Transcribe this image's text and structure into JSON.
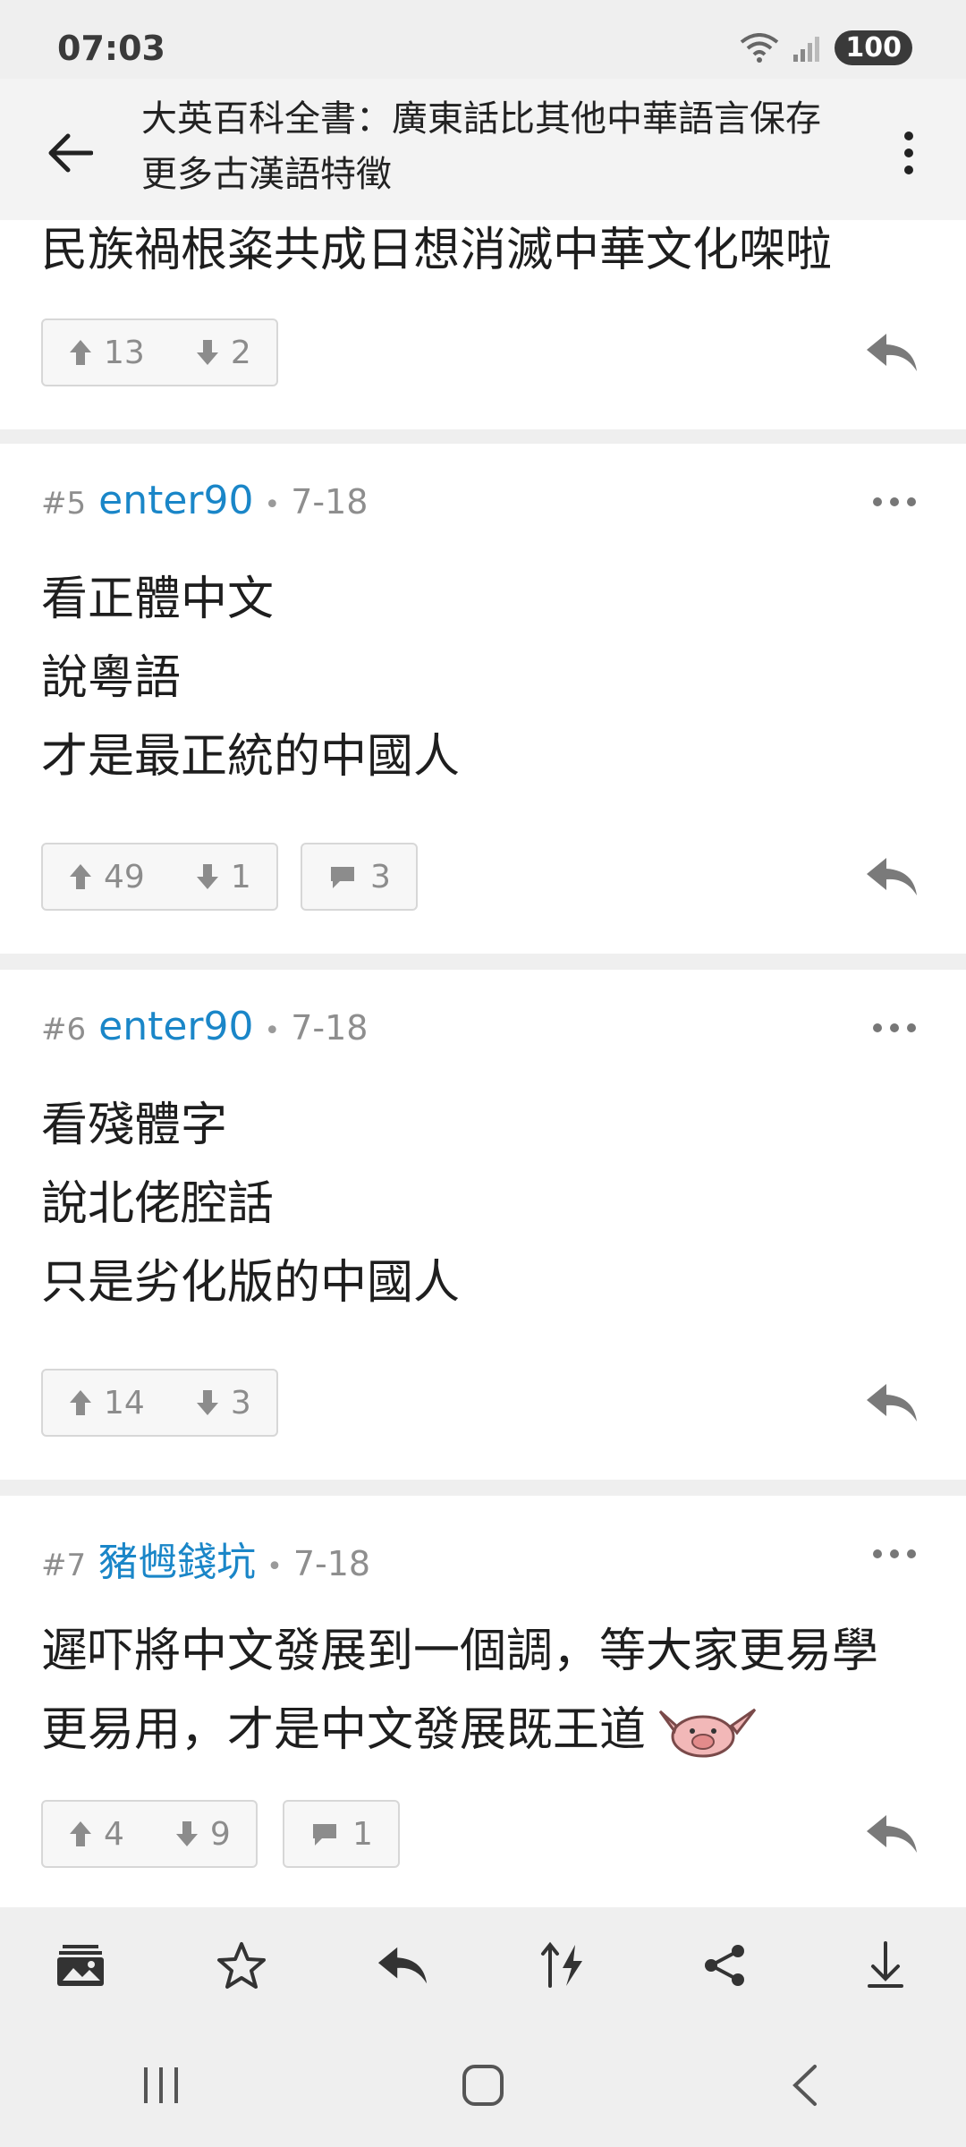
{
  "status": {
    "time": "07:03",
    "battery": "100"
  },
  "header": {
    "title": "大英百科全書：廣東話比其他中華語言保存更多古漢語特徵"
  },
  "posts": [
    {
      "body_lines": [
        "民族禍根粢共成日想消滅中華文化㗎啦"
      ],
      "up": "13",
      "down": "2"
    },
    {
      "number": "#5",
      "user": "enter90",
      "date": "7-18",
      "body_lines": [
        "看正體中文",
        "說粵語",
        "才是最正統的中國人"
      ],
      "up": "49",
      "down": "1",
      "comments": "3"
    },
    {
      "number": "#6",
      "user": "enter90",
      "date": "7-18",
      "body_lines": [
        "看殘體字",
        "說北佬腔話",
        "只是劣化版的中國人"
      ],
      "up": "14",
      "down": "3"
    },
    {
      "number": "#7",
      "user": "豬乸錢坑",
      "date": "7-18",
      "body_lines": [
        "遲吓將中文發展到一個調，等大家更易學",
        "更易用，才是中文發展既王道"
      ],
      "up": "4",
      "down": "9",
      "comments": "1"
    }
  ],
  "toolbar_icons": [
    "gallery-icon",
    "star-icon",
    "reply-icon",
    "sort-icon",
    "share-icon",
    "download-icon"
  ],
  "colors": {
    "username": "#1a86c8",
    "background": "#efefef",
    "card": "#ffffff"
  }
}
